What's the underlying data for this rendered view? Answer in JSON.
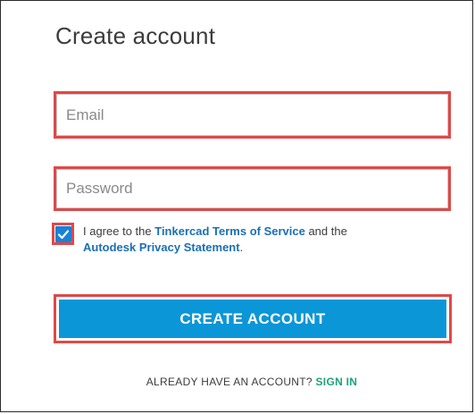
{
  "form": {
    "title": "Create account",
    "email": {
      "placeholder": "Email",
      "value": ""
    },
    "password": {
      "placeholder": "Password",
      "value": ""
    },
    "agree": {
      "checked": true,
      "text_before": "I agree to the ",
      "tos_link": "Tinkercad Terms of Service",
      "text_middle": " and the ",
      "privacy_link": "Autodesk Privacy Statement",
      "text_after": "."
    },
    "submit_label": "CREATE ACCOUNT",
    "signin": {
      "prompt": "ALREADY HAVE AN ACCOUNT? ",
      "link_label": "SIGN IN"
    }
  },
  "colors": {
    "highlight_border": "#e04848",
    "primary_button": "#0b96d8",
    "link_blue": "#1a6fb5",
    "link_green": "#1aa37a",
    "checkbox_fill": "#1a82d6"
  },
  "icons": {
    "checkbox": "checkmark-icon"
  }
}
